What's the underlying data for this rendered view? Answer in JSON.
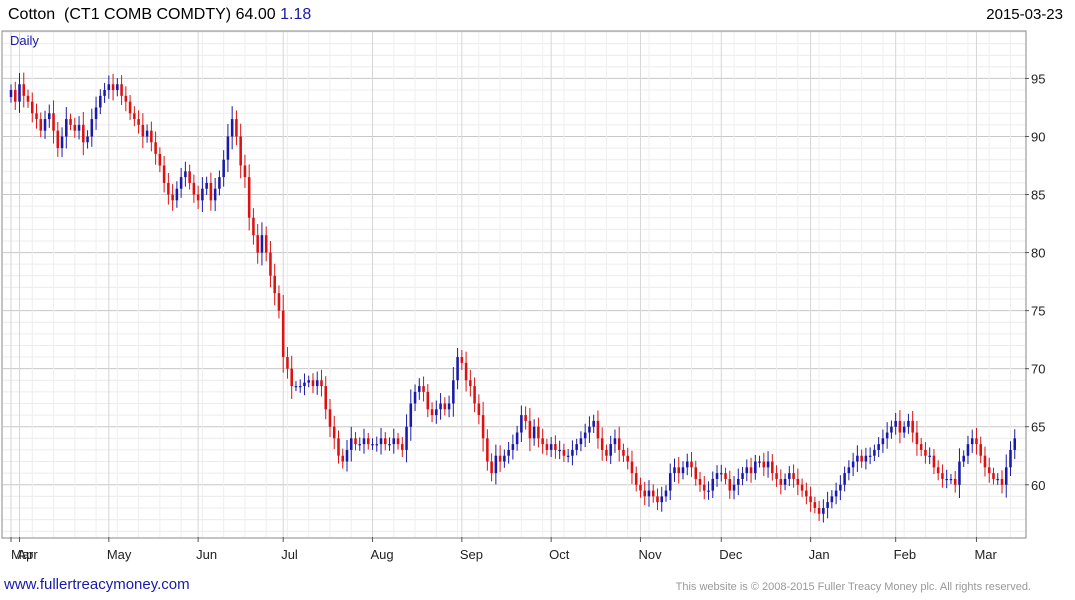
{
  "header": {
    "title_name": "Cotton",
    "title_ticker": "(CT1 COMB COMDTY)",
    "last_price": "64.00",
    "change": "1.18",
    "date": "2015-03-23"
  },
  "footer": {
    "left": "www.fullertreacymoney.com",
    "right": "This website is © 2008-2015 Fuller Treacy Money plc. All rights reserved."
  },
  "chart_data": {
    "type": "bar",
    "subtype": "candlestick",
    "period_label": "Daily",
    "y_ticks": [
      60,
      65,
      70,
      75,
      80,
      85,
      90,
      95
    ],
    "ylim": [
      55.5,
      99
    ],
    "x_tick_labels": [
      "Mar",
      "Apr",
      "May",
      "Jun",
      "Jul",
      "Aug",
      "Sep",
      "Oct",
      "Nov",
      "Dec",
      "Jan",
      "Feb",
      "Mar"
    ],
    "grid": true,
    "up_color": "#1a1aaa",
    "down_color": "#dd1111",
    "approx_daily_close": [
      {
        "month": "Mar",
        "values": [
          94.0,
          93.0
        ]
      },
      {
        "month": "Apr",
        "values": [
          94.5,
          93.5,
          93.0,
          92.0,
          91.5,
          90.5,
          91.5,
          92.0,
          90.5,
          89.0,
          90.0,
          91.5,
          91.0,
          90.5,
          91.0,
          89.5,
          90.0,
          91.5,
          92.5,
          93.5,
          94.0
        ]
      },
      {
        "month": "May",
        "values": [
          94.5,
          94.0,
          94.5,
          93.5,
          93.0,
          92.0,
          91.5,
          91.0,
          90.0,
          90.5,
          89.5,
          88.5,
          87.5,
          86.0,
          85.0,
          84.5,
          85.5,
          86.5,
          87.0,
          86.0,
          85.0
        ]
      },
      {
        "month": "Jun",
        "values": [
          84.5,
          85.5,
          86.0,
          84.5,
          85.5,
          86.5,
          88.0,
          90.0,
          91.5,
          90.0,
          87.5,
          86.5,
          83.0,
          81.5,
          80.0,
          81.5,
          80.0,
          78.0,
          76.5,
          75.0
        ]
      },
      {
        "month": "Jul",
        "values": [
          71.0,
          70.0,
          68.5,
          68.5,
          68.5,
          68.8,
          69.0,
          68.5,
          69.0,
          68.5,
          66.5,
          65.0,
          64.0,
          62.5,
          62.0,
          63.0,
          64.0,
          63.5,
          63.5,
          64.0,
          63.5
        ]
      },
      {
        "month": "Aug",
        "values": [
          63.5,
          63.5,
          64.0,
          63.5,
          63.5,
          64.0,
          63.5,
          63.0,
          65.0,
          67.0,
          68.0,
          68.5,
          68.0,
          66.5,
          66.0,
          66.5,
          67.0,
          66.5,
          67.0,
          69.0,
          71.0
        ]
      },
      {
        "month": "Sep",
        "values": [
          70.5,
          69.0,
          68.5,
          67.0,
          66.0,
          64.0,
          62.0,
          61.0,
          62.5,
          62.0,
          62.5,
          63.0,
          63.5,
          64.5,
          66.0,
          65.5,
          64.0,
          65.0,
          64.0,
          63.5,
          63.0
        ]
      },
      {
        "month": "Oct",
        "values": [
          63.5,
          63.0,
          63.0,
          62.5,
          62.5,
          63.0,
          63.5,
          64.0,
          64.5,
          65.0,
          65.5,
          64.0,
          63.0,
          62.5,
          63.5,
          64.0,
          63.0,
          62.5,
          62.0,
          61.0,
          60.0
        ]
      },
      {
        "month": "Nov",
        "values": [
          59.5,
          59.0,
          59.5,
          59.0,
          58.5,
          59.0,
          59.5,
          61.0,
          61.5,
          61.0,
          61.5,
          62.0,
          61.5,
          60.5,
          60.0,
          59.5,
          59.5,
          60.5,
          61.0
        ]
      },
      {
        "month": "Dec",
        "values": [
          61.0,
          60.5,
          59.5,
          60.0,
          60.5,
          61.0,
          61.5,
          61.0,
          62.0,
          62.0,
          61.5,
          62.0,
          61.0,
          60.5,
          60.0,
          60.5,
          61.0,
          60.5,
          60.0,
          59.5,
          59.0
        ]
      },
      {
        "month": "Jan",
        "values": [
          58.5,
          58.0,
          57.5,
          58.0,
          58.5,
          59.0,
          59.5,
          60.0,
          61.0,
          61.5,
          62.0,
          62.5,
          62.0,
          62.5,
          62.5,
          63.0,
          63.5,
          64.0,
          64.5,
          65.0
        ]
      },
      {
        "month": "Feb",
        "values": [
          65.5,
          64.5,
          65.0,
          65.5,
          64.5,
          63.5,
          63.0,
          62.5,
          62.5,
          61.5,
          61.0,
          60.5,
          60.5,
          60.5,
          60.0,
          62.0,
          62.5,
          63.5,
          64.0
        ]
      },
      {
        "month": "Mar",
        "values": [
          63.5,
          62.5,
          61.5,
          61.0,
          60.5,
          60.5,
          60.0,
          61.5,
          63.0,
          64.0
        ]
      }
    ]
  }
}
